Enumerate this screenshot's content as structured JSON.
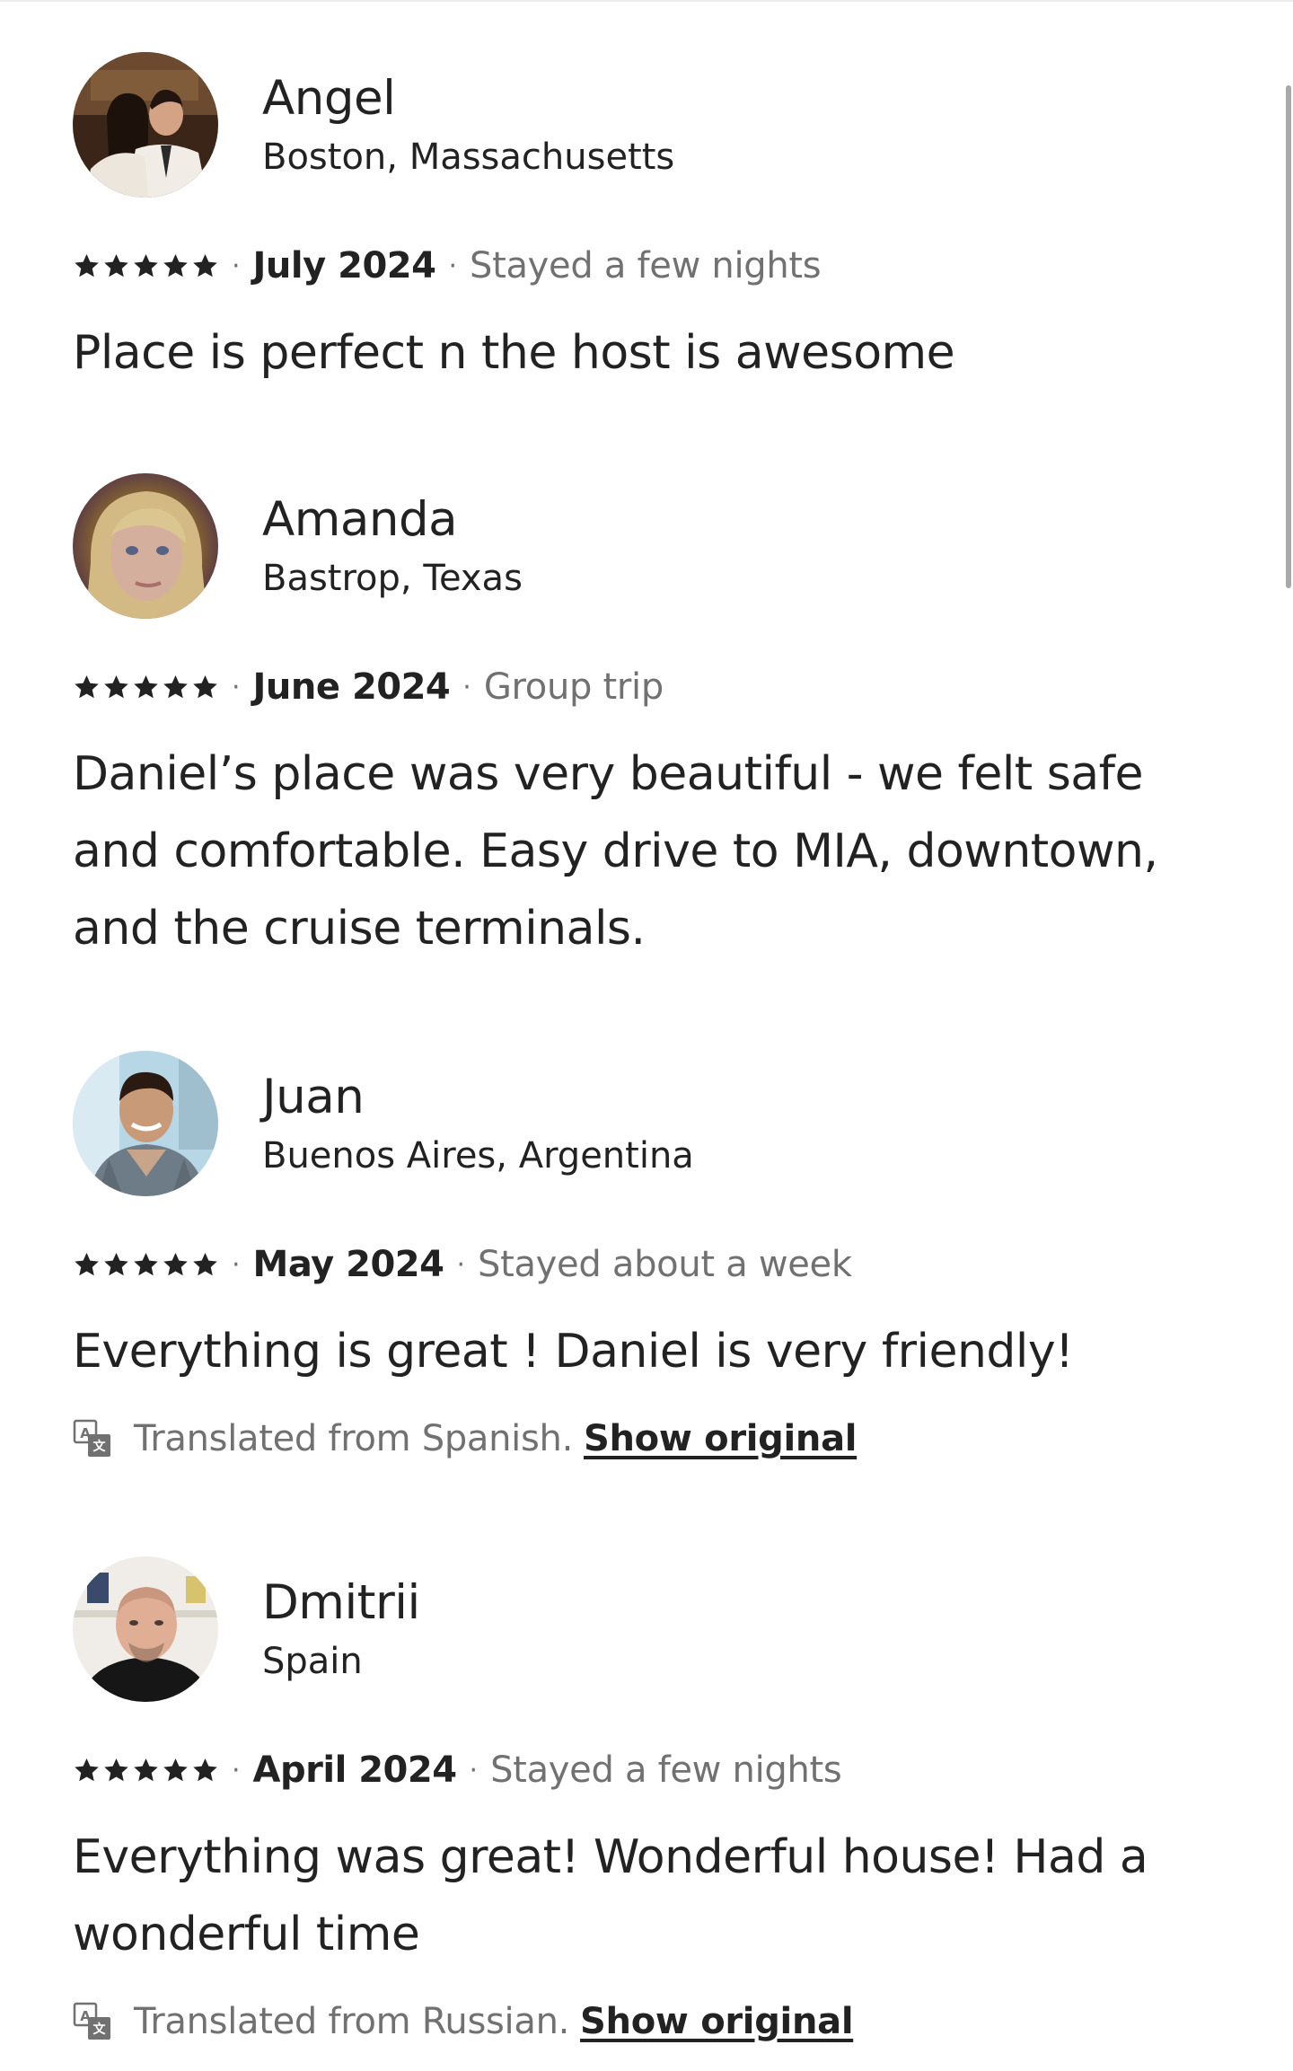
{
  "reviews": [
    {
      "name": "Angel",
      "location": "Boston, Massachusetts",
      "rating": 5,
      "date": "July 2024",
      "trip_type": "Stayed a few nights",
      "text": "Place is perfect n the host is awesome"
    },
    {
      "name": "Amanda",
      "location": "Bastrop, Texas",
      "rating": 5,
      "date": "June 2024",
      "trip_type": "Group trip",
      "text": "Daniel’s place was very beautiful - we felt safe and comfortable. Easy drive to MIA, downtown, and the cruise terminals."
    },
    {
      "name": "Juan",
      "location": "Buenos Aires, Argentina",
      "rating": 5,
      "date": "May 2024",
      "trip_type": "Stayed about a week",
      "text": "Everything is great ! Daniel is very friendly!",
      "translation_note": "Translated from Spanish.",
      "show_original": "Show original"
    },
    {
      "name": "Dmitrii",
      "location": "Spain",
      "rating": 5,
      "date": "April 2024",
      "trip_type": "Stayed a few nights",
      "text": "Everything was great! Wonderful house! Had a wonderful time",
      "translation_note": "Translated from Russian.",
      "show_original": "Show original"
    }
  ],
  "separator": "·",
  "icons": {
    "star": "star-icon",
    "translate": "translate-icon"
  },
  "colors": {
    "text_primary": "#222222",
    "text_secondary": "#717171"
  }
}
